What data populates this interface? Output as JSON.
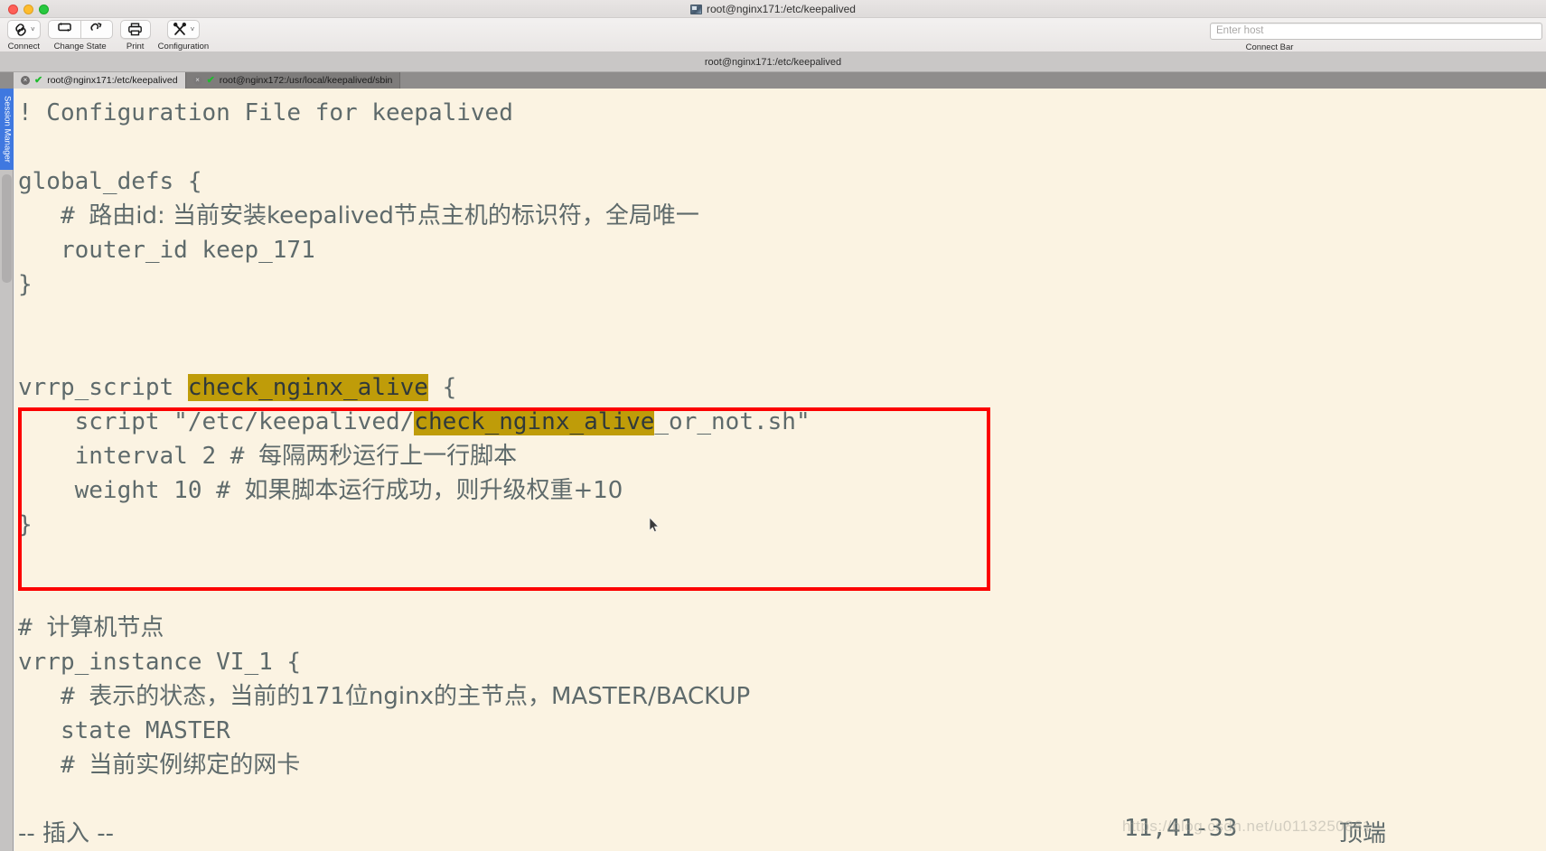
{
  "window": {
    "title": "root@nginx171:/etc/keepalived",
    "app_icon": "terminal-icon",
    "traffic_lights": {
      "close": "close-button",
      "minimize": "minimize-button",
      "maximize": "maximize-button"
    }
  },
  "toolbar": {
    "items": [
      {
        "label": "Connect",
        "icon": "link-icon",
        "caret": "˅"
      },
      {
        "label": "Change State",
        "icon": "reconnect-icon",
        "icon2": "disconnect-icon"
      },
      {
        "label": "Print",
        "icon": "printer-icon"
      },
      {
        "label": "Configuration",
        "icon": "tools-icon",
        "caret": "˅"
      }
    ],
    "connect_bar": {
      "label": "Connect Bar",
      "host_placeholder": "Enter host",
      "host_value": ""
    }
  },
  "path_strip": {
    "text": "root@nginx171:/etc/keepalived"
  },
  "tabs": [
    {
      "label": "root@nginx171:/etc/keepalived",
      "active": true,
      "status": "connected",
      "close": "×",
      "check": "✔"
    },
    {
      "label": "root@nginx172:/usr/local/keepalived/sbin",
      "active": false,
      "status": "connected",
      "close": "×",
      "check": "✔"
    }
  ],
  "sidebar": {
    "rail_label": "Session Manager"
  },
  "terminal": {
    "background_color": "#fbf3e2",
    "text_color": "#5e6a6b",
    "highlight_color": "#bf9c09",
    "annotation_color": "#fc0000",
    "lines": [
      {
        "id": "l1",
        "segments": [
          {
            "t": "! Configuration File for keepalived"
          }
        ]
      },
      {
        "id": "l2",
        "segments": [
          {
            "t": ""
          }
        ]
      },
      {
        "id": "l3",
        "segments": [
          {
            "t": "global_defs {"
          }
        ]
      },
      {
        "id": "l4",
        "segments": [
          {
            "t": "   # "
          },
          {
            "t": "路由id: 当前安装keepalived节点主机的标识符，全局唯一",
            "cjk": true
          }
        ]
      },
      {
        "id": "l5",
        "segments": [
          {
            "t": "   router_id keep_171"
          }
        ]
      },
      {
        "id": "l6",
        "segments": [
          {
            "t": "}"
          }
        ]
      },
      {
        "id": "l7",
        "segments": [
          {
            "t": ""
          }
        ]
      },
      {
        "id": "l8",
        "segments": [
          {
            "t": ""
          }
        ]
      },
      {
        "id": "l9",
        "segments": [
          {
            "t": "vrrp_script "
          },
          {
            "t": "check_nginx_alive",
            "hl": true
          },
          {
            "t": " {"
          }
        ]
      },
      {
        "id": "l10",
        "segments": [
          {
            "t": "    script \"/etc/keepalived/"
          },
          {
            "t": "check_nginx_alive",
            "hl": true
          },
          {
            "t": "_or_not.sh\""
          }
        ]
      },
      {
        "id": "l11",
        "segments": [
          {
            "t": "    interval 2 # "
          },
          {
            "t": "每隔两秒运行上一行脚本",
            "cjk": true
          }
        ]
      },
      {
        "id": "l12",
        "segments": [
          {
            "t": "    weight 10 # "
          },
          {
            "t": "如果脚本运行成功，则升级权重+10",
            "cjk": true
          }
        ]
      },
      {
        "id": "l13",
        "segments": [
          {
            "t": "}"
          }
        ]
      },
      {
        "id": "l14",
        "segments": [
          {
            "t": ""
          }
        ]
      },
      {
        "id": "l15",
        "segments": [
          {
            "t": ""
          }
        ]
      },
      {
        "id": "l16",
        "segments": [
          {
            "t": "# "
          },
          {
            "t": "计算机节点",
            "cjk": true
          }
        ]
      },
      {
        "id": "l17",
        "segments": [
          {
            "t": "vrrp_instance VI_1 {"
          }
        ]
      },
      {
        "id": "l18",
        "segments": [
          {
            "t": "   # "
          },
          {
            "t": "表示的状态，当前的171位nginx的主节点，MASTER/BACKUP",
            "cjk": true
          }
        ]
      },
      {
        "id": "l19",
        "segments": [
          {
            "t": "   state MASTER"
          }
        ]
      },
      {
        "id": "l20",
        "segments": [
          {
            "t": "   # "
          },
          {
            "t": "当前实例绑定的网卡",
            "cjk": true
          }
        ]
      }
    ]
  },
  "status_bar": {
    "mode": "-- 插入 --",
    "position": "11,41-33",
    "scroll": "顶端"
  },
  "watermark": {
    "text": "https://blog.csdn.net/u0113250861"
  }
}
